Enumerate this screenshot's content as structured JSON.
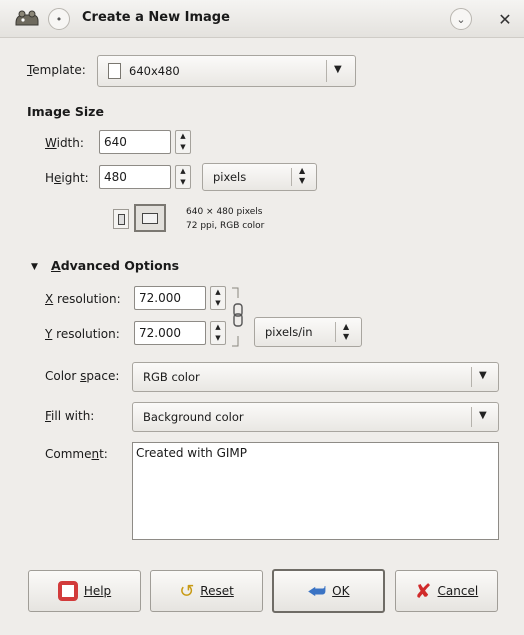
{
  "window": {
    "title": "Create a New Image"
  },
  "template": {
    "label": "Template:",
    "value": "640x480"
  },
  "image_size": {
    "heading": "Image Size",
    "width_label": "Width:",
    "width_value": "640",
    "height_label": "Height:",
    "height_value": "480",
    "unit": "pixels",
    "info_line1": "640 × 480 pixels",
    "info_line2": "72 ppi, RGB color"
  },
  "advanced": {
    "heading": "Advanced Options",
    "xres_label": "X resolution:",
    "xres_value": "72.000",
    "yres_label": "Y resolution:",
    "yres_value": "72.000",
    "res_unit": "pixels/in",
    "colorspace_label": "Color space:",
    "colorspace_value": "RGB color",
    "fill_label": "Fill with:",
    "fill_value": "Background color",
    "comment_label": "Comment:",
    "comment_value": "Created with GIMP"
  },
  "buttons": {
    "help": "Help",
    "reset": "Reset",
    "ok": "OK",
    "cancel": "Cancel"
  },
  "icons": {
    "app": "gimp-wilber-icon",
    "menu": "window-menu-icon",
    "minimize": "chevron-down-icon",
    "close": "close-icon",
    "template": "page-icon",
    "portrait": "portrait-orientation-icon",
    "landscape": "landscape-orientation-icon",
    "expander": "triangle-down-icon",
    "chain": "chain-link-icon",
    "help": "lifebuoy-icon",
    "reset": "reset-icon",
    "ok": "arrow-left-icon",
    "cancel": "red-x-icon"
  }
}
